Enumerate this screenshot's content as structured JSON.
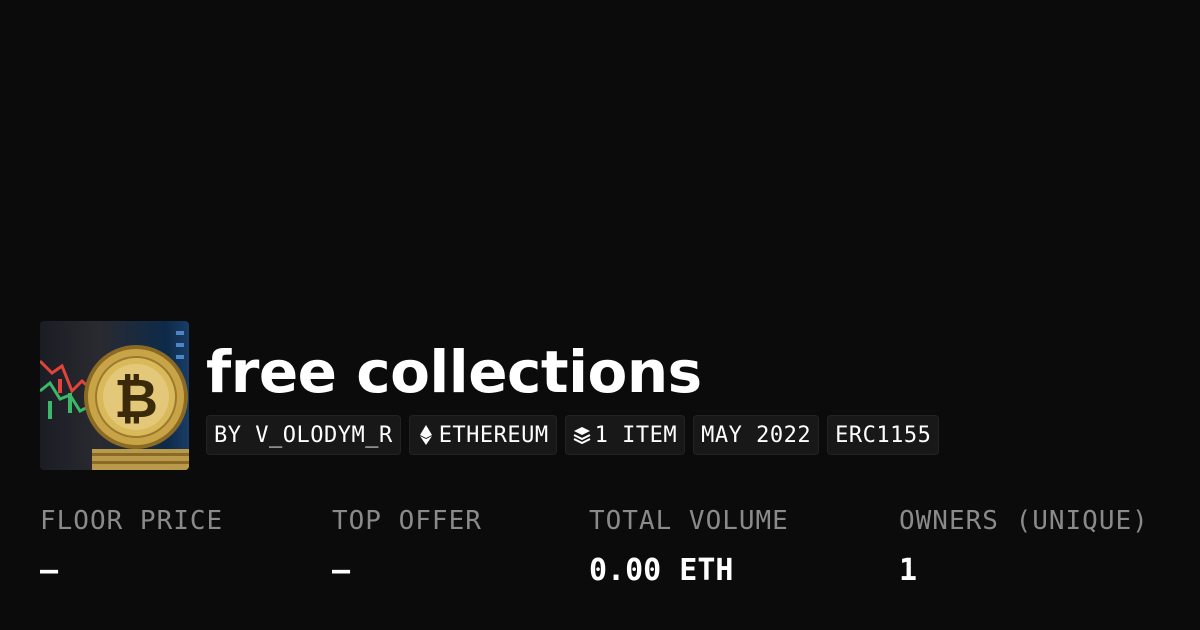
{
  "collection": {
    "title": "free collections",
    "thumbnail_icon": "bitcoin-coin-icon"
  },
  "chips": {
    "creator": "BY V_OLODYM_R",
    "chain_icon": "ethereum-icon",
    "chain": "ETHEREUM",
    "items_icon": "layers-icon",
    "items": "1 ITEM",
    "date": "MAY 2022",
    "standard": "ERC1155"
  },
  "stats": {
    "floor_price": {
      "label": "FLOOR PRICE",
      "value": "–"
    },
    "top_offer": {
      "label": "TOP OFFER",
      "value": "–"
    },
    "total_volume": {
      "label": "TOTAL VOLUME",
      "value": "0.00 ETH"
    },
    "owners": {
      "label": "OWNERS (UNIQUE)",
      "value": "1"
    }
  },
  "colors": {
    "background": "#0b0b0b",
    "label_gray": "#8a8a8a",
    "chip_bg": "#181818",
    "coin_gold": "#c9a447"
  }
}
